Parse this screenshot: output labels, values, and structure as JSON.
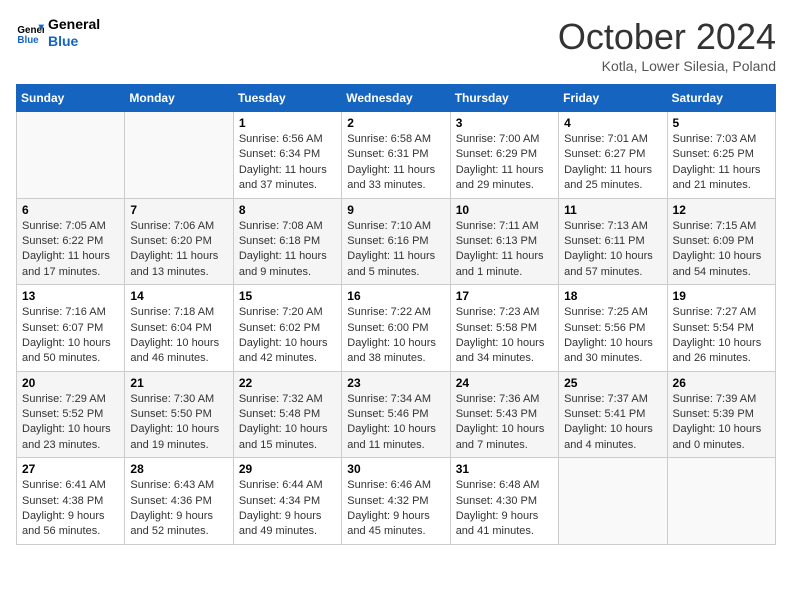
{
  "header": {
    "logo_line1": "General",
    "logo_line2": "Blue",
    "month": "October 2024",
    "location": "Kotla, Lower Silesia, Poland"
  },
  "days_of_week": [
    "Sunday",
    "Monday",
    "Tuesday",
    "Wednesday",
    "Thursday",
    "Friday",
    "Saturday"
  ],
  "weeks": [
    [
      {
        "day": "",
        "sunrise": "",
        "sunset": "",
        "daylight": ""
      },
      {
        "day": "",
        "sunrise": "",
        "sunset": "",
        "daylight": ""
      },
      {
        "day": "1",
        "sunrise": "Sunrise: 6:56 AM",
        "sunset": "Sunset: 6:34 PM",
        "daylight": "Daylight: 11 hours and 37 minutes."
      },
      {
        "day": "2",
        "sunrise": "Sunrise: 6:58 AM",
        "sunset": "Sunset: 6:31 PM",
        "daylight": "Daylight: 11 hours and 33 minutes."
      },
      {
        "day": "3",
        "sunrise": "Sunrise: 7:00 AM",
        "sunset": "Sunset: 6:29 PM",
        "daylight": "Daylight: 11 hours and 29 minutes."
      },
      {
        "day": "4",
        "sunrise": "Sunrise: 7:01 AM",
        "sunset": "Sunset: 6:27 PM",
        "daylight": "Daylight: 11 hours and 25 minutes."
      },
      {
        "day": "5",
        "sunrise": "Sunrise: 7:03 AM",
        "sunset": "Sunset: 6:25 PM",
        "daylight": "Daylight: 11 hours and 21 minutes."
      }
    ],
    [
      {
        "day": "6",
        "sunrise": "Sunrise: 7:05 AM",
        "sunset": "Sunset: 6:22 PM",
        "daylight": "Daylight: 11 hours and 17 minutes."
      },
      {
        "day": "7",
        "sunrise": "Sunrise: 7:06 AM",
        "sunset": "Sunset: 6:20 PM",
        "daylight": "Daylight: 11 hours and 13 minutes."
      },
      {
        "day": "8",
        "sunrise": "Sunrise: 7:08 AM",
        "sunset": "Sunset: 6:18 PM",
        "daylight": "Daylight: 11 hours and 9 minutes."
      },
      {
        "day": "9",
        "sunrise": "Sunrise: 7:10 AM",
        "sunset": "Sunset: 6:16 PM",
        "daylight": "Daylight: 11 hours and 5 minutes."
      },
      {
        "day": "10",
        "sunrise": "Sunrise: 7:11 AM",
        "sunset": "Sunset: 6:13 PM",
        "daylight": "Daylight: 11 hours and 1 minute."
      },
      {
        "day": "11",
        "sunrise": "Sunrise: 7:13 AM",
        "sunset": "Sunset: 6:11 PM",
        "daylight": "Daylight: 10 hours and 57 minutes."
      },
      {
        "day": "12",
        "sunrise": "Sunrise: 7:15 AM",
        "sunset": "Sunset: 6:09 PM",
        "daylight": "Daylight: 10 hours and 54 minutes."
      }
    ],
    [
      {
        "day": "13",
        "sunrise": "Sunrise: 7:16 AM",
        "sunset": "Sunset: 6:07 PM",
        "daylight": "Daylight: 10 hours and 50 minutes."
      },
      {
        "day": "14",
        "sunrise": "Sunrise: 7:18 AM",
        "sunset": "Sunset: 6:04 PM",
        "daylight": "Daylight: 10 hours and 46 minutes."
      },
      {
        "day": "15",
        "sunrise": "Sunrise: 7:20 AM",
        "sunset": "Sunset: 6:02 PM",
        "daylight": "Daylight: 10 hours and 42 minutes."
      },
      {
        "day": "16",
        "sunrise": "Sunrise: 7:22 AM",
        "sunset": "Sunset: 6:00 PM",
        "daylight": "Daylight: 10 hours and 38 minutes."
      },
      {
        "day": "17",
        "sunrise": "Sunrise: 7:23 AM",
        "sunset": "Sunset: 5:58 PM",
        "daylight": "Daylight: 10 hours and 34 minutes."
      },
      {
        "day": "18",
        "sunrise": "Sunrise: 7:25 AM",
        "sunset": "Sunset: 5:56 PM",
        "daylight": "Daylight: 10 hours and 30 minutes."
      },
      {
        "day": "19",
        "sunrise": "Sunrise: 7:27 AM",
        "sunset": "Sunset: 5:54 PM",
        "daylight": "Daylight: 10 hours and 26 minutes."
      }
    ],
    [
      {
        "day": "20",
        "sunrise": "Sunrise: 7:29 AM",
        "sunset": "Sunset: 5:52 PM",
        "daylight": "Daylight: 10 hours and 23 minutes."
      },
      {
        "day": "21",
        "sunrise": "Sunrise: 7:30 AM",
        "sunset": "Sunset: 5:50 PM",
        "daylight": "Daylight: 10 hours and 19 minutes."
      },
      {
        "day": "22",
        "sunrise": "Sunrise: 7:32 AM",
        "sunset": "Sunset: 5:48 PM",
        "daylight": "Daylight: 10 hours and 15 minutes."
      },
      {
        "day": "23",
        "sunrise": "Sunrise: 7:34 AM",
        "sunset": "Sunset: 5:46 PM",
        "daylight": "Daylight: 10 hours and 11 minutes."
      },
      {
        "day": "24",
        "sunrise": "Sunrise: 7:36 AM",
        "sunset": "Sunset: 5:43 PM",
        "daylight": "Daylight: 10 hours and 7 minutes."
      },
      {
        "day": "25",
        "sunrise": "Sunrise: 7:37 AM",
        "sunset": "Sunset: 5:41 PM",
        "daylight": "Daylight: 10 hours and 4 minutes."
      },
      {
        "day": "26",
        "sunrise": "Sunrise: 7:39 AM",
        "sunset": "Sunset: 5:39 PM",
        "daylight": "Daylight: 10 hours and 0 minutes."
      }
    ],
    [
      {
        "day": "27",
        "sunrise": "Sunrise: 6:41 AM",
        "sunset": "Sunset: 4:38 PM",
        "daylight": "Daylight: 9 hours and 56 minutes."
      },
      {
        "day": "28",
        "sunrise": "Sunrise: 6:43 AM",
        "sunset": "Sunset: 4:36 PM",
        "daylight": "Daylight: 9 hours and 52 minutes."
      },
      {
        "day": "29",
        "sunrise": "Sunrise: 6:44 AM",
        "sunset": "Sunset: 4:34 PM",
        "daylight": "Daylight: 9 hours and 49 minutes."
      },
      {
        "day": "30",
        "sunrise": "Sunrise: 6:46 AM",
        "sunset": "Sunset: 4:32 PM",
        "daylight": "Daylight: 9 hours and 45 minutes."
      },
      {
        "day": "31",
        "sunrise": "Sunrise: 6:48 AM",
        "sunset": "Sunset: 4:30 PM",
        "daylight": "Daylight: 9 hours and 41 minutes."
      },
      {
        "day": "",
        "sunrise": "",
        "sunset": "",
        "daylight": ""
      },
      {
        "day": "",
        "sunrise": "",
        "sunset": "",
        "daylight": ""
      }
    ]
  ]
}
